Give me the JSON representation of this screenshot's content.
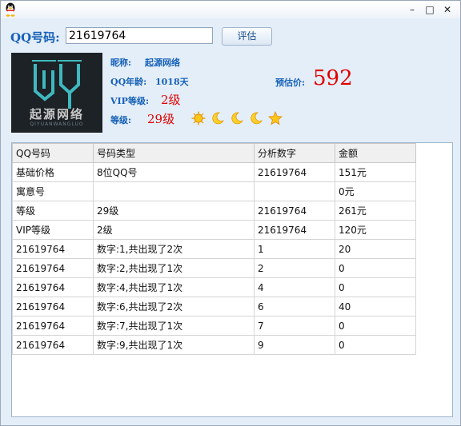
{
  "window": {
    "controls": {
      "minimize": "–",
      "maximize": "□",
      "close": "✕"
    }
  },
  "search": {
    "label": "QQ号码:",
    "value": "21619764",
    "button": "评估"
  },
  "avatar": {
    "logo_text": "起源网络",
    "logo_sub": "QIYUANWANGLUO"
  },
  "profile": {
    "nickname_label": "昵称:",
    "nickname": "起源网络",
    "age_label": "QQ年龄:",
    "age": "1018天",
    "vip_label": "VIP等级:",
    "vip": "2级",
    "level_label": "等级:",
    "level": "29级",
    "level_icons": [
      "sun-icon",
      "moon-icon",
      "moon-icon",
      "moon-icon",
      "star-icon"
    ],
    "price_label": "预估价:",
    "price": "592"
  },
  "table": {
    "headers": [
      "QQ号码",
      "号码类型",
      "分析数字",
      "金额"
    ],
    "rows": [
      [
        "基础价格",
        "8位QQ号",
        "21619764",
        "151元"
      ],
      [
        "寓意号",
        "",
        "",
        "0元"
      ],
      [
        "等级",
        "29级",
        "21619764",
        "261元"
      ],
      [
        "VIP等级",
        "2级",
        "21619764",
        "120元"
      ],
      [
        "21619764",
        "数字:1,共出现了2次",
        "1",
        "20"
      ],
      [
        "21619764",
        "数字:2,共出现了1次",
        "2",
        "0"
      ],
      [
        "21619764",
        "数字:4,共出现了1次",
        "4",
        "0"
      ],
      [
        "21619764",
        "数字:6,共出现了2次",
        "6",
        "40"
      ],
      [
        "21619764",
        "数字:7,共出现了1次",
        "7",
        "0"
      ],
      [
        "21619764",
        "数字:9,共出现了1次",
        "9",
        "0"
      ]
    ]
  },
  "colors": {
    "accent": "#1661b8",
    "highlight": "#e00000",
    "window_bg": "#e4eef9"
  }
}
